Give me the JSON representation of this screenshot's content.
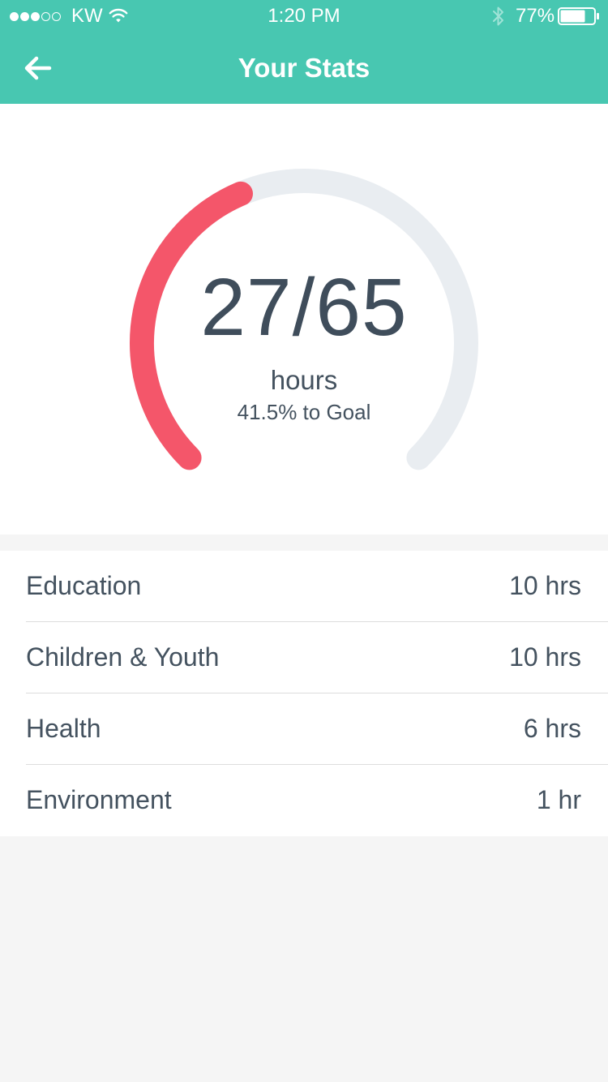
{
  "status_bar": {
    "signal_bars_filled": 3,
    "signal_bars_total": 5,
    "carrier": "KW",
    "time": "1:20 PM",
    "battery_percent": "77%",
    "battery_level": 0.77,
    "icons": [
      "wifi-icon",
      "bluetooth-icon",
      "battery-icon"
    ]
  },
  "nav": {
    "back_icon": "arrow-left-icon",
    "title": "Your Stats"
  },
  "gauge": {
    "total_text": "27/65",
    "unit_label": "hours",
    "goal_text": "41.5% to Goal",
    "hours_completed": 27,
    "hours_goal": 65,
    "progress_fraction": 0.415,
    "progress_color": "#f4566a",
    "track_color": "#e9edf1"
  },
  "categories": [
    {
      "label": "Education",
      "hours": "10 hrs"
    },
    {
      "label": "Children & Youth",
      "hours": "10 hrs"
    },
    {
      "label": "Health",
      "hours": "6 hrs"
    },
    {
      "label": "Environment",
      "hours": "1 hr"
    }
  ],
  "colors": {
    "header_bg": "#48c7b1",
    "text_primary": "#44525f",
    "page_bg": "#f5f5f5"
  }
}
